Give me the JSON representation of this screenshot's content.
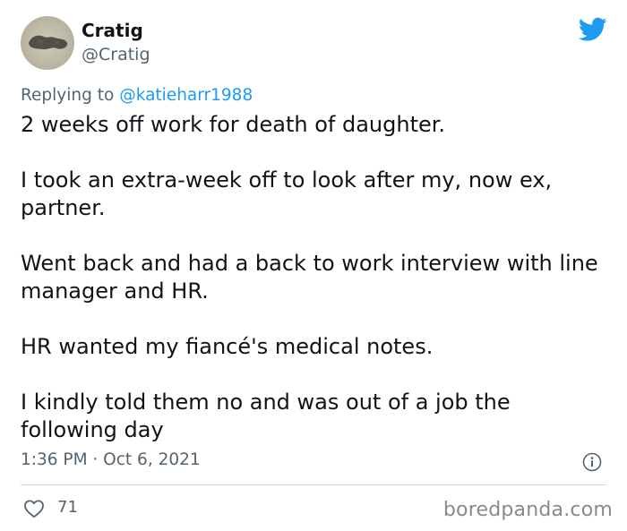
{
  "author": {
    "display_name": "Cratig",
    "handle": "@Cratig"
  },
  "reply": {
    "prefix": "Replying to ",
    "mention": "@katieharr1988"
  },
  "body": {
    "paragraphs": [
      "2 weeks off work for death of daughter.",
      "I took an extra-week off to look after my, now ex, partner.",
      "Went back and had a back to work interview with line manager and HR.",
      "HR wanted my fiancé's medical notes.",
      "I kindly told them no and was out of a job the following day"
    ]
  },
  "meta": {
    "timestamp": "1:36 PM · Oct 6, 2021"
  },
  "engagement": {
    "likes": "71"
  },
  "watermark": "boredpanda.com",
  "icons": {
    "brand": "twitter-bird-icon",
    "info": "info-icon",
    "like": "heart-icon"
  },
  "colors": {
    "twitter_blue": "#1d9bf0",
    "secondary_text": "#536471",
    "primary_text": "#0f1419"
  }
}
